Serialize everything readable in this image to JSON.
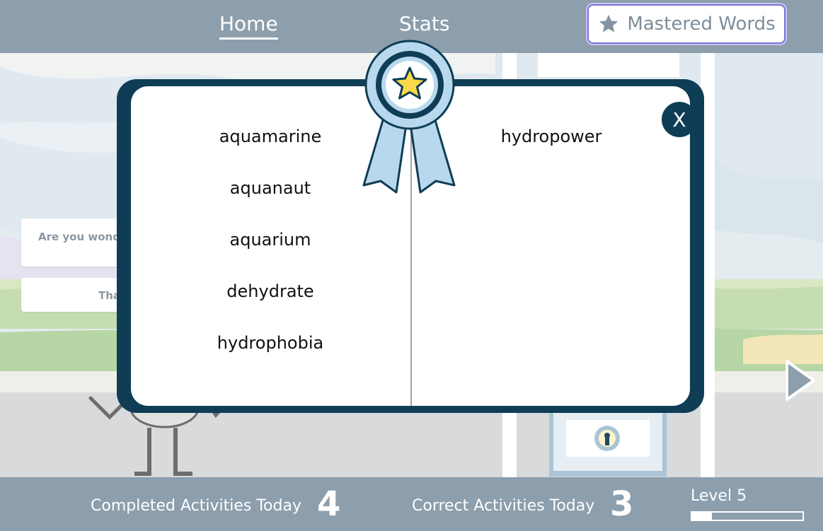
{
  "nav": {
    "home": "Home",
    "stats": "Stats",
    "mastered": "Mastered Words",
    "mastered_icon": "star-icon"
  },
  "background": {
    "card1_text": "Are you wonde",
    "card2_text": "Tha"
  },
  "modal": {
    "badge_icon": "award-ribbon-icon",
    "close_label": "X",
    "left_words": [
      "aquamarine",
      "aquanaut",
      "aquarium",
      "dehydrate",
      "hydrophobia"
    ],
    "right_words": [
      "hydropower"
    ]
  },
  "footer": {
    "completed_label": "Completed Activities Today",
    "completed_value": "4",
    "correct_label": "Correct Activities Today",
    "correct_value": "3",
    "level_label": "Level 5",
    "level_progress": 0.18
  },
  "colors": {
    "bar": "#8d9eac",
    "modal_frame": "#0f3d55",
    "accent": "#7a72d8",
    "star": "#f9d84a",
    "ribbon": "#b8d8ee"
  }
}
